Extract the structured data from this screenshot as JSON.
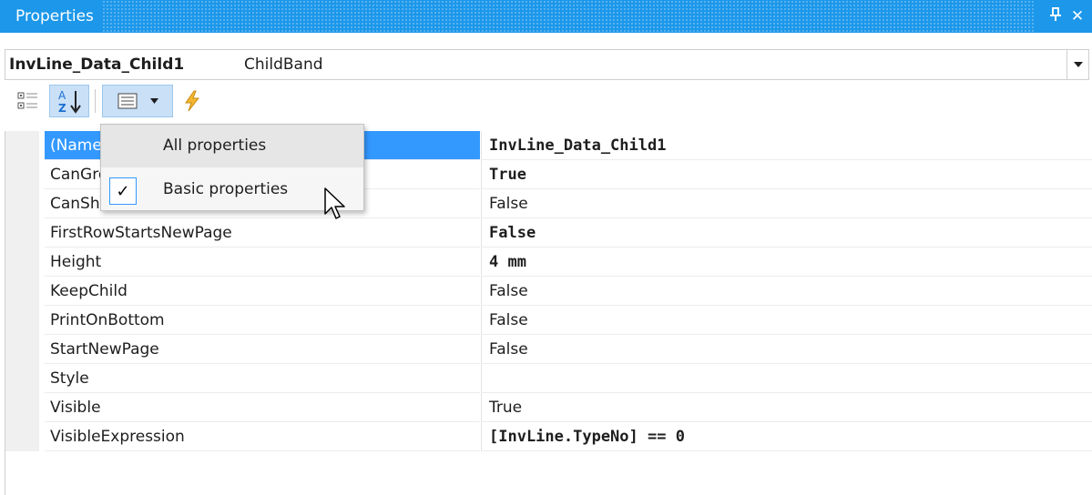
{
  "window": {
    "title": "Properties",
    "pin_glyph": "Ͱ",
    "close_glyph": "✕"
  },
  "object_selector": {
    "name": "InvLine_Data_Child1",
    "type": "ChildBand"
  },
  "properties": [
    {
      "name": "(Name)",
      "value": "InvLine_Data_Child1",
      "bold": true,
      "selected": true
    },
    {
      "name": "CanGrow",
      "value": "True",
      "bold": true
    },
    {
      "name": "CanShrink",
      "value": "False",
      "bold": false
    },
    {
      "name": "FirstRowStartsNewPage",
      "value": "False",
      "bold": true
    },
    {
      "name": "Height",
      "value": "4 mm",
      "bold": true
    },
    {
      "name": "KeepChild",
      "value": "False",
      "bold": false
    },
    {
      "name": "PrintOnBottom",
      "value": "False",
      "bold": false
    },
    {
      "name": "StartNewPage",
      "value": "False",
      "bold": false
    },
    {
      "name": "Style",
      "value": "",
      "bold": false
    },
    {
      "name": "Visible",
      "value": "True",
      "bold": false
    },
    {
      "name": "VisibleExpression",
      "value": "[InvLine.TypeNo] == 0",
      "bold": true
    }
  ],
  "menu": {
    "items": [
      {
        "label": "All properties",
        "checked": false
      },
      {
        "label": "Basic properties",
        "checked": true
      }
    ],
    "check_glyph": "✓"
  },
  "colors": {
    "accent": "#1c97ea",
    "selection": "#3399ff"
  }
}
